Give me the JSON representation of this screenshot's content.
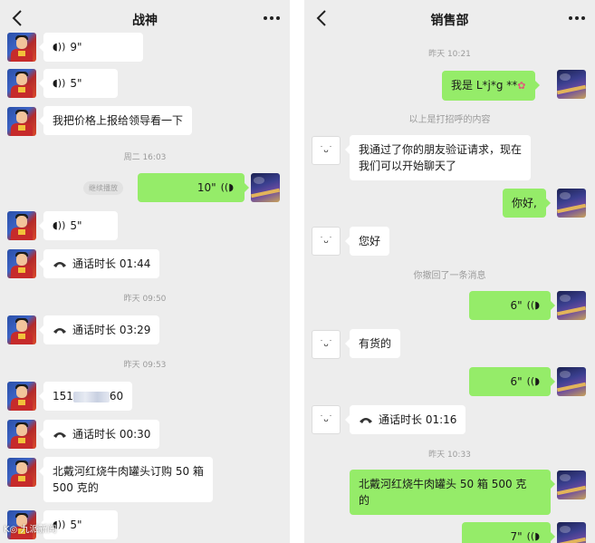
{
  "left": {
    "title": "战神",
    "timestamps": [
      "周二 16:03",
      "昨天 09:50",
      "昨天 09:53"
    ],
    "messages": {
      "voice_9": "9\"",
      "voice_5a": "5\"",
      "report": "我把价格上报给领导看一下",
      "voice_out_10": "10\"",
      "listen_badge": "继续播放",
      "voice_5b": "5\"",
      "call_1": "通话时长 01:44",
      "call_2": "通话时长 03:29",
      "phone_prefix": "151",
      "phone_suffix": "60",
      "call_3": "通话时长 00:30",
      "order_line1": "北戴河红烧牛肉罐头订购 50 箱",
      "order_line2": "500 克的",
      "voice_5c": "5\""
    },
    "watermark": "K◎ 九派新闻"
  },
  "right": {
    "title": "销售部",
    "timestamps": [
      "昨天 10:21",
      "昨天 10:33"
    ],
    "system": {
      "greeting_note": "以上是打招呼的内容",
      "recall_note": "你撤回了一条消息"
    },
    "messages": {
      "i_am": "我是 L*j*g  **",
      "verify_line1": "我通过了你的朋友验证请求，现在",
      "verify_line2": "我们可以开始聊天了",
      "hello_out": "你好,",
      "hello_in": "您好",
      "voice_6a": "6\"",
      "in_stock": "有货的",
      "voice_6b": "6\"",
      "call": "通话时长 01:16",
      "order_line1": "北戴河红烧牛肉罐头 50 箱 500 克",
      "order_line2": "的",
      "voice_7": "7\""
    },
    "avatar_face": "˙ᴗ˙"
  },
  "colors": {
    "background": "#ededed",
    "bubble_out": "#95ec69",
    "bubble_in": "#ffffff",
    "meta_text": "#9b9b9b"
  },
  "icons": [
    "back-arrow-icon",
    "more-dots-icon",
    "voice-wave-icon",
    "phone-call-icon",
    "sticker-icon"
  ]
}
